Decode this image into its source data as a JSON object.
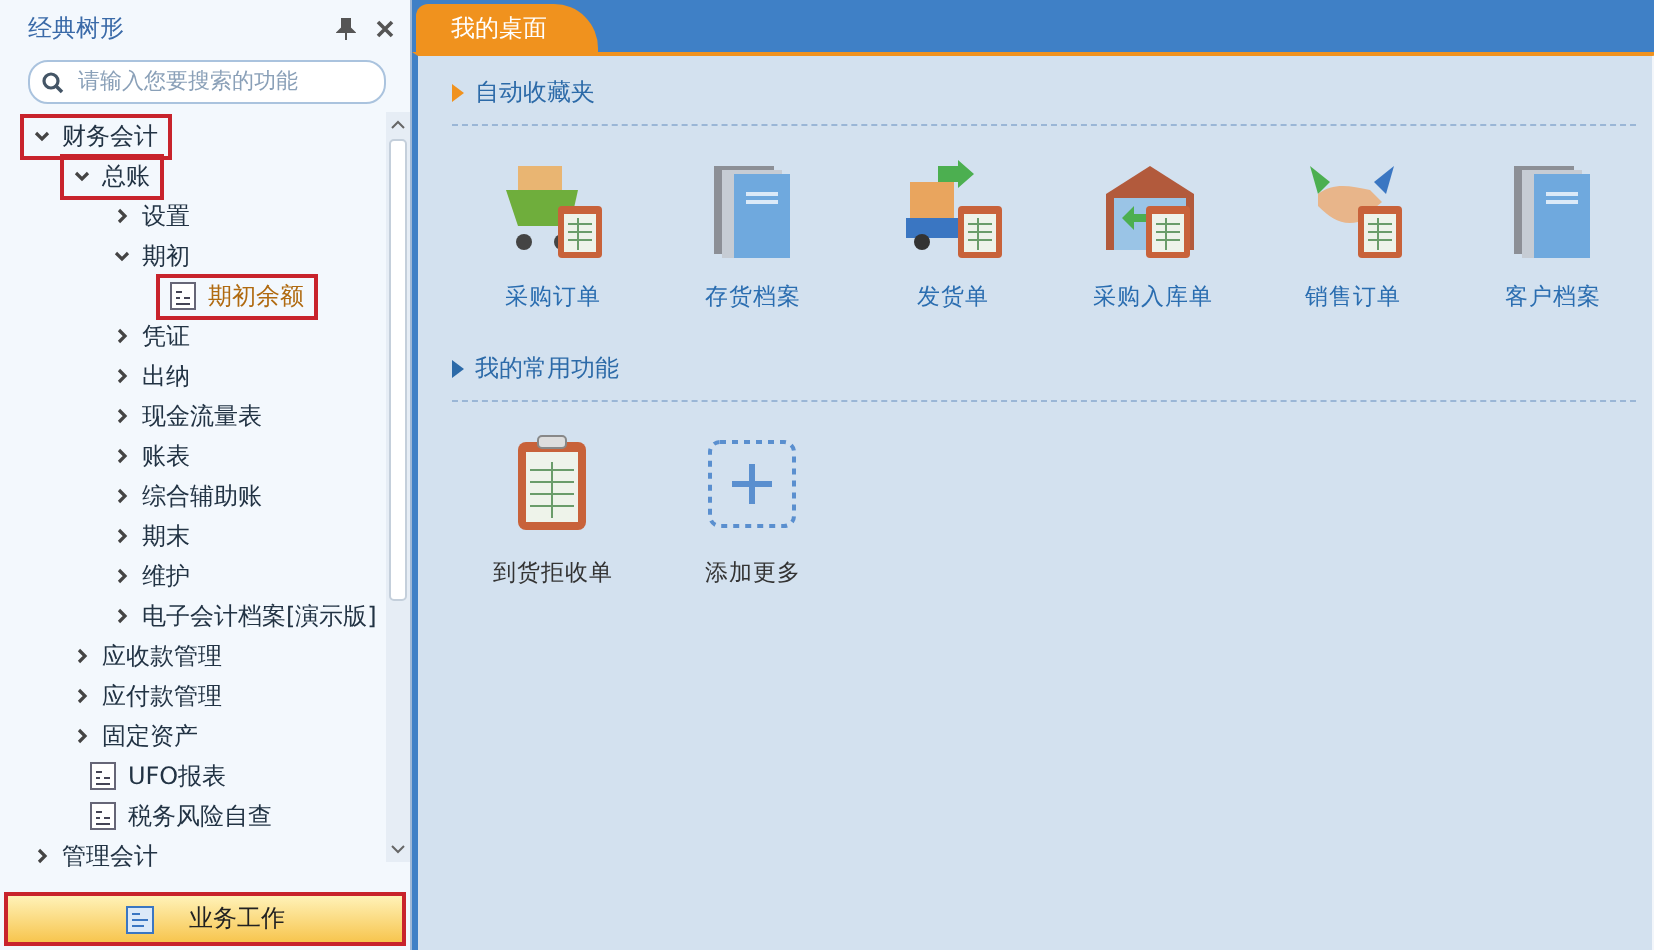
{
  "sidebar": {
    "title": "经典树形",
    "search": {
      "placeholder": "请输入您要搜索的功能"
    },
    "tree": [
      {
        "label": "财务会计",
        "kind": "folder",
        "expanded": true,
        "highlighted": true,
        "children": [
          {
            "label": "总账",
            "kind": "folder",
            "expanded": true,
            "highlighted": true,
            "children": [
              {
                "label": "设置",
                "kind": "folder",
                "expanded": false,
                "highlighted": false
              },
              {
                "label": "期初",
                "kind": "folder",
                "expanded": true,
                "highlighted": false,
                "children": [
                  {
                    "label": "期初余额",
                    "kind": "document",
                    "highlighted": true
                  }
                ]
              },
              {
                "label": "凭证",
                "kind": "folder",
                "expanded": false,
                "highlighted": false
              },
              {
                "label": "出纳",
                "kind": "folder",
                "expanded": false,
                "highlighted": false
              },
              {
                "label": "现金流量表",
                "kind": "folder",
                "expanded": false,
                "highlighted": false
              },
              {
                "label": "账表",
                "kind": "folder",
                "expanded": false,
                "highlighted": false
              },
              {
                "label": "综合辅助账",
                "kind": "folder",
                "expanded": false,
                "highlighted": false
              },
              {
                "label": "期末",
                "kind": "folder",
                "expanded": false,
                "highlighted": false
              },
              {
                "label": "维护",
                "kind": "folder",
                "expanded": false,
                "highlighted": false
              },
              {
                "label": "电子会计档案[演示版]",
                "kind": "folder",
                "expanded": false,
                "highlighted": false
              }
            ]
          },
          {
            "label": "应收款管理",
            "kind": "folder",
            "expanded": false,
            "highlighted": false
          },
          {
            "label": "应付款管理",
            "kind": "folder",
            "expanded": false,
            "highlighted": false
          },
          {
            "label": "固定资产",
            "kind": "folder",
            "expanded": false,
            "highlighted": false
          },
          {
            "label": "UFO报表",
            "kind": "document",
            "highlighted": false
          },
          {
            "label": "税务风险自查",
            "kind": "document",
            "highlighted": false
          }
        ]
      },
      {
        "label": "管理会计",
        "kind": "folder",
        "expanded": false,
        "highlighted": false
      }
    ],
    "bottom_button": {
      "label": "业务工作",
      "highlighted": true
    }
  },
  "tabs": [
    {
      "label": "我的桌面",
      "selected": true
    }
  ],
  "sections": [
    {
      "title": "自动收藏夹",
      "items": [
        {
          "label": "采购订单",
          "kind": "cart"
        },
        {
          "label": "存货档案",
          "kind": "book"
        },
        {
          "label": "发货单",
          "kind": "truck"
        },
        {
          "label": "采购入库单",
          "kind": "warehouse"
        },
        {
          "label": "销售订单",
          "kind": "handshake"
        },
        {
          "label": "客户档案",
          "kind": "book"
        }
      ]
    },
    {
      "title": "我的常用功能",
      "items": [
        {
          "label": "到货拒收单",
          "kind": "clipboard"
        },
        {
          "label": "添加更多",
          "kind": "add"
        }
      ]
    }
  ]
}
